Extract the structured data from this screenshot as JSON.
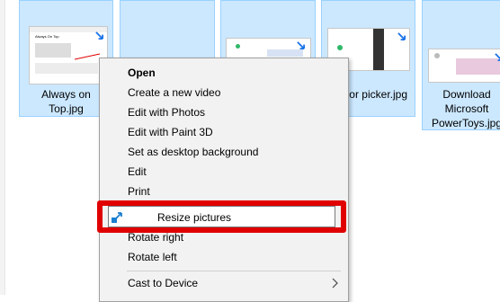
{
  "files": [
    {
      "id": "always-on-top",
      "label_lines": [
        "Always on",
        "Top.jpg"
      ]
    },
    {
      "id": "file-2",
      "label_lines": []
    },
    {
      "id": "file-3",
      "label_lines": []
    },
    {
      "id": "color-picker",
      "label_lines": [
        "or picker.jpg"
      ]
    },
    {
      "id": "download-powertoys",
      "label_lines": [
        "Download",
        "Microsoft",
        "PowerToys.jpg"
      ]
    }
  ],
  "thumbnail": {
    "title": "Always On Top"
  },
  "context_menu": {
    "items": [
      {
        "label": "Open",
        "bold": true
      },
      {
        "label": "Create a new video"
      },
      {
        "label": "Edit with Photos"
      },
      {
        "label": "Edit with Paint 3D"
      },
      {
        "label": "Set as desktop background"
      },
      {
        "label": "Edit"
      },
      {
        "label": "Print"
      },
      {
        "label": "Resize pictures",
        "icon": "resize-pictures-icon",
        "highlighted": true
      },
      {
        "label": "Rotate right"
      },
      {
        "label": "Rotate left"
      },
      {
        "label": "Cast to Device",
        "submenu": true
      }
    ]
  },
  "colors": {
    "selection": "#cce8ff",
    "highlight_border": "#e00000",
    "accent": "#0078d7"
  }
}
